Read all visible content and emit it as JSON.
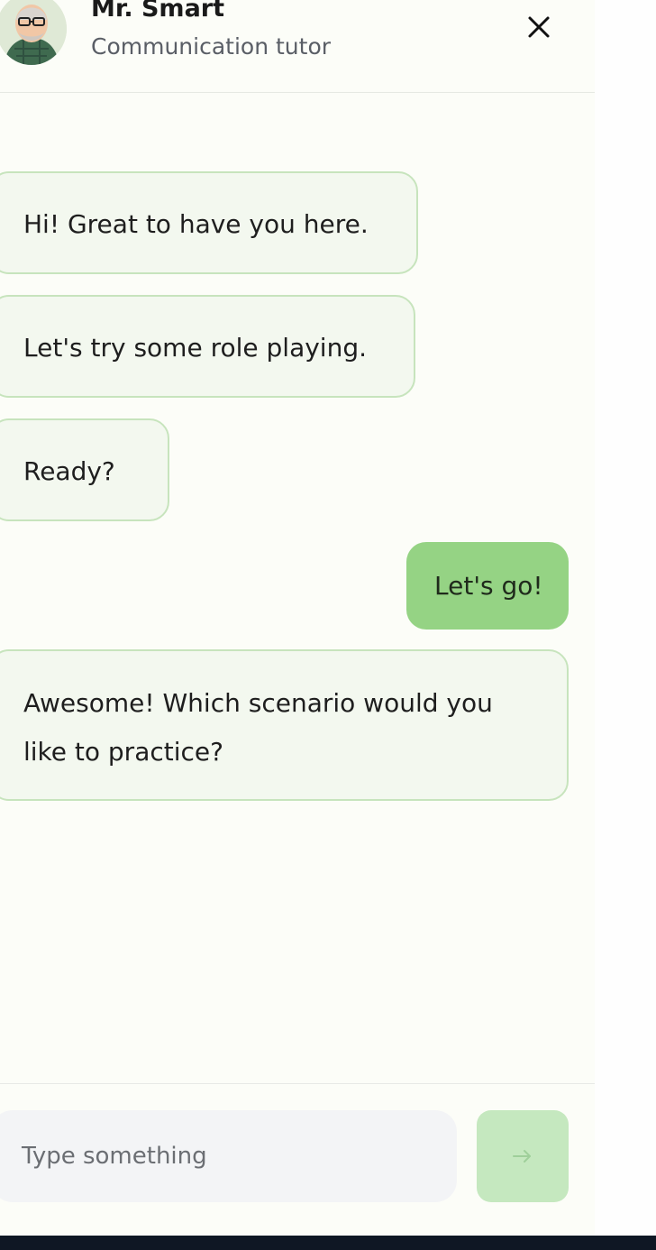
{
  "header": {
    "title": "Mr. Smart",
    "subtitle": "Communication tutor"
  },
  "messages": [
    {
      "sender": "bot",
      "text": "Hi! Great to have you here."
    },
    {
      "sender": "bot",
      "text": "Let's try some role playing."
    },
    {
      "sender": "bot",
      "text": "Ready?"
    },
    {
      "sender": "user",
      "text": "Let's go!"
    },
    {
      "sender": "bot",
      "text_line1": "Awesome! Which scenario would you",
      "text_line2": "like to practice?"
    }
  ],
  "composer": {
    "placeholder": "Type something",
    "send_icon": "arrow-right-icon"
  },
  "icons": {
    "close": "close-icon",
    "avatar": "avatar-illustration"
  },
  "colors": {
    "bot_bubble_bg": "#f3f8ef",
    "bot_bubble_border": "#c7e4bd",
    "user_bubble_bg": "#95d384",
    "send_button_bg": "#c5e8bf"
  }
}
